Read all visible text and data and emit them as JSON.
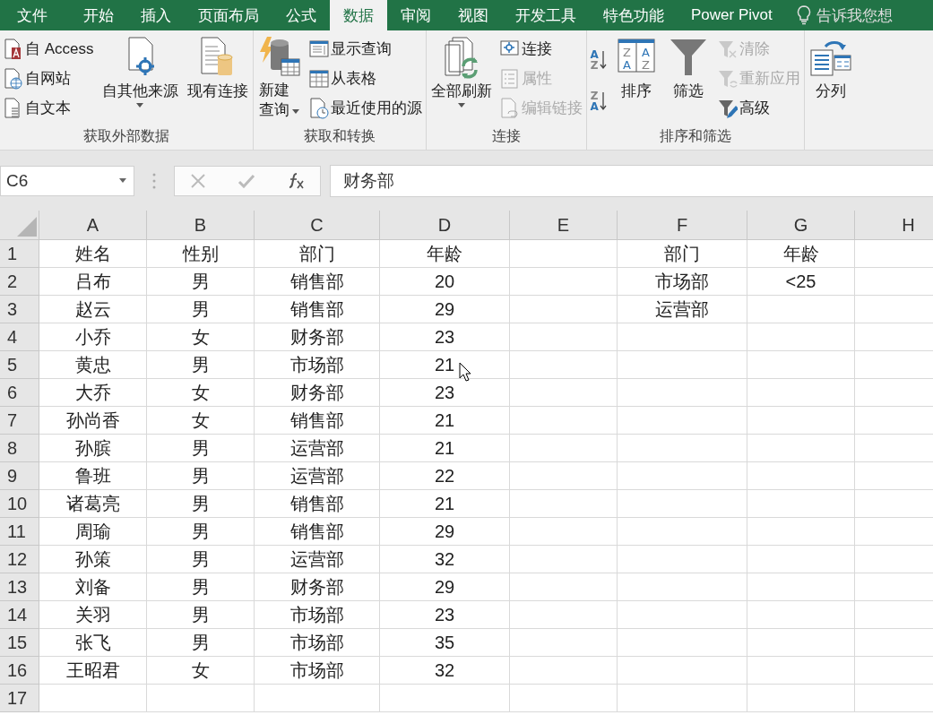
{
  "tabs": [
    {
      "label": "文件",
      "selected": false
    },
    {
      "label": "开始",
      "selected": false
    },
    {
      "label": "插入",
      "selected": false
    },
    {
      "label": "页面布局",
      "selected": false
    },
    {
      "label": "公式",
      "selected": false
    },
    {
      "label": "数据",
      "selected": true
    },
    {
      "label": "审阅",
      "selected": false
    },
    {
      "label": "视图",
      "selected": false
    },
    {
      "label": "开发工具",
      "selected": false
    },
    {
      "label": "特色功能",
      "selected": false
    },
    {
      "label": "Power Pivot",
      "selected": false
    }
  ],
  "tell_me": {
    "placeholder": "告诉我您想"
  },
  "ribbon_groups": [
    {
      "label": "获取外部数据",
      "controls": [
        {
          "kind": "stack",
          "items": [
            {
              "label": "自 Access",
              "disabled": false
            },
            {
              "label": "自网站",
              "disabled": false
            },
            {
              "label": "自文本",
              "disabled": false
            }
          ]
        },
        {
          "kind": "large",
          "label": "自其他来源",
          "dropdown": true
        },
        {
          "kind": "large",
          "label": "现有连接",
          "dropdown": false
        }
      ]
    },
    {
      "label": "获取和转换",
      "controls": [
        {
          "kind": "large",
          "label": "新建查询",
          "dropdown": true
        },
        {
          "kind": "stack",
          "items": [
            {
              "label": "显示查询",
              "disabled": false
            },
            {
              "label": "从表格",
              "disabled": false
            },
            {
              "label": "最近使用的源",
              "disabled": false
            }
          ]
        }
      ]
    },
    {
      "label": "连接",
      "controls": [
        {
          "kind": "large",
          "label": "全部刷新",
          "dropdown": true
        },
        {
          "kind": "stack",
          "items": [
            {
              "label": "连接",
              "disabled": false
            },
            {
              "label": "属性",
              "disabled": true
            },
            {
              "label": "编辑链接",
              "disabled": true
            }
          ]
        }
      ]
    },
    {
      "label": "排序和筛选",
      "controls": [
        {
          "kind": "sort-buttons",
          "buttons": [
            [
              "A",
              "Z"
            ],
            [
              "Z",
              "A"
            ]
          ]
        },
        {
          "kind": "large",
          "label": "排序",
          "dropdown": false,
          "icon_letters": [
            "Z",
            "A",
            "A",
            "Z"
          ]
        },
        {
          "kind": "large",
          "label": "筛选",
          "dropdown": false
        },
        {
          "kind": "stack",
          "items": [
            {
              "label": "清除",
              "disabled": true
            },
            {
              "label": "重新应用",
              "disabled": true
            },
            {
              "label": "高级",
              "disabled": false
            }
          ]
        }
      ]
    },
    {
      "controls": [
        {
          "kind": "large",
          "label": "分列",
          "dropdown": false
        }
      ]
    }
  ],
  "name_box": "C6",
  "formula": "财务部",
  "columns": [
    "A",
    "B",
    "C",
    "D",
    "E",
    "F",
    "G",
    "H"
  ],
  "rows": [
    {
      "number": "1",
      "cells": [
        "姓名",
        "性别",
        "部门",
        "年龄",
        null,
        "部门",
        "年龄"
      ]
    },
    {
      "number": "2",
      "cells": [
        "吕布",
        "男",
        "销售部",
        "20",
        null,
        "市场部",
        "<25"
      ]
    },
    {
      "number": "3",
      "cells": [
        "赵云",
        "男",
        "销售部",
        "29",
        null,
        "运营部"
      ]
    },
    {
      "number": "4",
      "cells": [
        "小乔",
        "女",
        "财务部",
        "23"
      ]
    },
    {
      "number": "5",
      "cells": [
        "黄忠",
        "男",
        "市场部",
        "21"
      ]
    },
    {
      "number": "6",
      "cells": [
        "大乔",
        "女",
        "财务部",
        "23"
      ]
    },
    {
      "number": "7",
      "cells": [
        "孙尚香",
        "女",
        "销售部",
        "21"
      ]
    },
    {
      "number": "8",
      "cells": [
        "孙膑",
        "男",
        "运营部",
        "21"
      ]
    },
    {
      "number": "9",
      "cells": [
        "鲁班",
        "男",
        "运营部",
        "22"
      ]
    },
    {
      "number": "10",
      "cells": [
        "诸葛亮",
        "男",
        "销售部",
        "21"
      ]
    },
    {
      "number": "11",
      "cells": [
        "周瑜",
        "男",
        "销售部",
        "29"
      ]
    },
    {
      "number": "12",
      "cells": [
        "孙策",
        "男",
        "运营部",
        "32"
      ]
    },
    {
      "number": "13",
      "cells": [
        "刘备",
        "男",
        "财务部",
        "29"
      ]
    },
    {
      "number": "14",
      "cells": [
        "关羽",
        "男",
        "市场部",
        "23"
      ]
    },
    {
      "number": "15",
      "cells": [
        "张飞",
        "男",
        "市场部",
        "35"
      ]
    },
    {
      "number": "16",
      "cells": [
        "王昭君",
        "女",
        "市场部",
        "32"
      ]
    },
    {
      "number": "17",
      "cells": []
    }
  ]
}
